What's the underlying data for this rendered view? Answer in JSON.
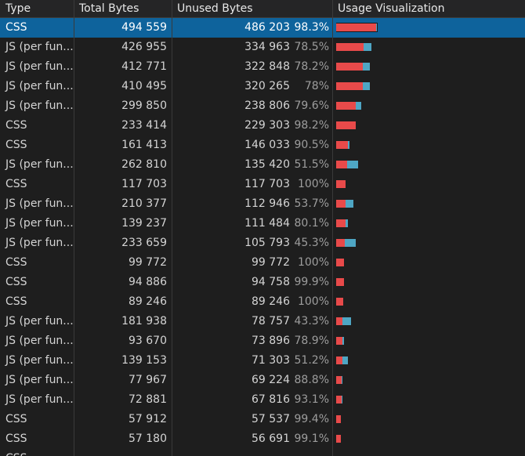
{
  "columns": {
    "type": "Type",
    "total": "Total Bytes",
    "unused": "Unused Bytes",
    "visualization": "Usage Visualization"
  },
  "max_total_bytes": 494559,
  "rows": [
    {
      "type": "CSS",
      "total": "494 559",
      "unused": "486 203",
      "pct": "98.3%",
      "total_n": 494559,
      "unused_n": 486203,
      "selected": true
    },
    {
      "type": "JS (per fun...",
      "total": "426 955",
      "unused": "334 963",
      "pct": "78.5%",
      "total_n": 426955,
      "unused_n": 334963
    },
    {
      "type": "JS (per fun...",
      "total": "412 771",
      "unused": "322 848",
      "pct": "78.2%",
      "total_n": 412771,
      "unused_n": 322848
    },
    {
      "type": "JS (per fun...",
      "total": "410 495",
      "unused": "320 265",
      "pct": "78%",
      "total_n": 410495,
      "unused_n": 320265
    },
    {
      "type": "JS (per fun...",
      "total": "299 850",
      "unused": "238 806",
      "pct": "79.6%",
      "total_n": 299850,
      "unused_n": 238806
    },
    {
      "type": "CSS",
      "total": "233 414",
      "unused": "229 303",
      "pct": "98.2%",
      "total_n": 233414,
      "unused_n": 229303
    },
    {
      "type": "CSS",
      "total": "161 413",
      "unused": "146 033",
      "pct": "90.5%",
      "total_n": 161413,
      "unused_n": 146033
    },
    {
      "type": "JS (per fun...",
      "total": "262 810",
      "unused": "135 420",
      "pct": "51.5%",
      "total_n": 262810,
      "unused_n": 135420
    },
    {
      "type": "CSS",
      "total": "117 703",
      "unused": "117 703",
      "pct": "100%",
      "total_n": 117703,
      "unused_n": 117703
    },
    {
      "type": "JS (per fun...",
      "total": "210 377",
      "unused": "112 946",
      "pct": "53.7%",
      "total_n": 210377,
      "unused_n": 112946
    },
    {
      "type": "JS (per fun...",
      "total": "139 237",
      "unused": "111 484",
      "pct": "80.1%",
      "total_n": 139237,
      "unused_n": 111484
    },
    {
      "type": "JS (per fun...",
      "total": "233 659",
      "unused": "105 793",
      "pct": "45.3%",
      "total_n": 233659,
      "unused_n": 105793
    },
    {
      "type": "CSS",
      "total": "99 772",
      "unused": "99 772",
      "pct": "100%",
      "total_n": 99772,
      "unused_n": 99772
    },
    {
      "type": "CSS",
      "total": "94 886",
      "unused": "94 758",
      "pct": "99.9%",
      "total_n": 94886,
      "unused_n": 94758
    },
    {
      "type": "CSS",
      "total": "89 246",
      "unused": "89 246",
      "pct": "100%",
      "total_n": 89246,
      "unused_n": 89246
    },
    {
      "type": "JS (per fun...",
      "total": "181 938",
      "unused": "78 757",
      "pct": "43.3%",
      "total_n": 181938,
      "unused_n": 78757
    },
    {
      "type": "JS (per fun...",
      "total": "93 670",
      "unused": "73 896",
      "pct": "78.9%",
      "total_n": 93670,
      "unused_n": 73896
    },
    {
      "type": "JS (per fun...",
      "total": "139 153",
      "unused": "71 303",
      "pct": "51.2%",
      "total_n": 139153,
      "unused_n": 71303
    },
    {
      "type": "JS (per fun...",
      "total": "77 967",
      "unused": "69 224",
      "pct": "88.8%",
      "total_n": 77967,
      "unused_n": 69224
    },
    {
      "type": "JS (per fun...",
      "total": "72 881",
      "unused": "67 816",
      "pct": "93.1%",
      "total_n": 72881,
      "unused_n": 67816
    },
    {
      "type": "CSS",
      "total": "57 912",
      "unused": "57 537",
      "pct": "99.4%",
      "total_n": 57912,
      "unused_n": 57537
    },
    {
      "type": "CSS",
      "total": "57 180",
      "unused": "56 691",
      "pct": "99.1%",
      "total_n": 57180,
      "unused_n": 56691
    },
    {
      "type": "CSS",
      "total": "",
      "unused": "",
      "pct": "",
      "total_n": 0,
      "unused_n": 0
    }
  ],
  "colors": {
    "unused_bar": "#e84a4a",
    "used_bar": "#4ea6c4",
    "selection": "#0e639c"
  }
}
